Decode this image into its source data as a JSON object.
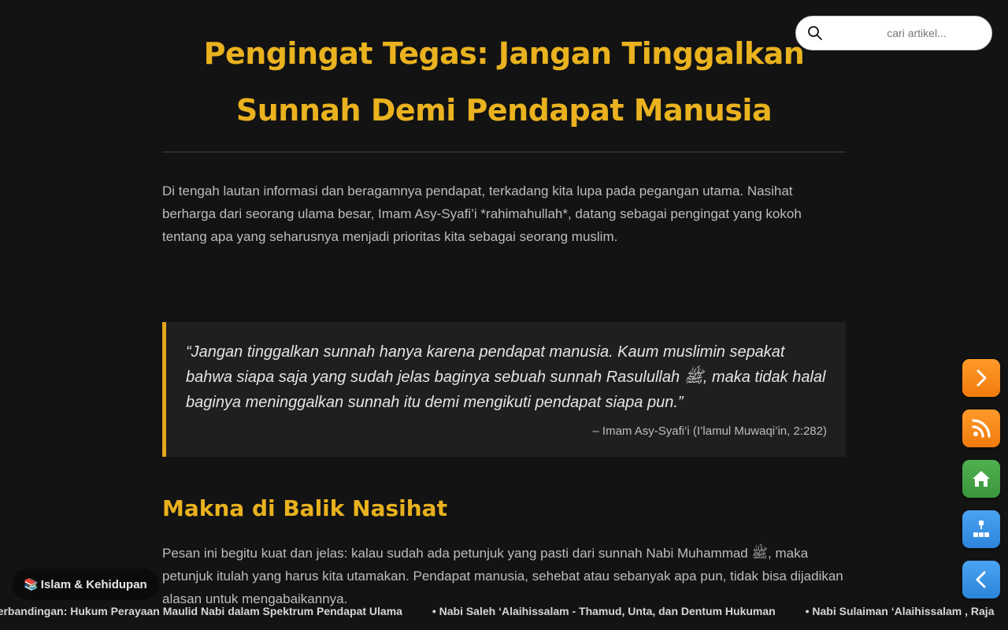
{
  "search": {
    "placeholder": "cari artikel...",
    "icon": "search-icon"
  },
  "article": {
    "title": "Pengingat Tegas: Jangan Tinggalkan Sunnah Demi Pendapat Manusia",
    "intro": "Di tengah lautan informasi dan beragamnya pendapat, terkadang kita lupa pada pegangan utama. Nasihat berharga dari seorang ulama besar, Imam Asy-Syafi’i *rahimahullah*, datang sebagai pengingat yang kokoh tentang apa yang seharusnya menjadi prioritas kita sebagai seorang muslim.",
    "quote": {
      "text": "“Jangan tinggalkan sunnah hanya karena pendapat manusia. Kaum muslimin sepakat bahwa siapa saja yang sudah jelas baginya sebuah sunnah Rasulullah ﷺ, maka tidak halal baginya meninggalkan sunnah itu demi mengikuti pendapat siapa pun.”",
      "source": "– Imam Asy-Syafi’i (I’lamul Muwaqi’in, 2:282)"
    },
    "section_heading": "Makna di Balik Nasihat",
    "section_body": "Pesan ini begitu kuat dan jelas: kalau sudah ada petunjuk yang pasti dari sunnah Nabi Muhammad ﷺ, maka petunjuk itulah yang harus kita utamakan. Pendapat manusia, sehebat atau sebanyak apa pun, tidak bisa dijadikan alasan untuk mengabaikannya."
  },
  "side_nav": [
    {
      "name": "next-post-button",
      "icon": "chevron-right-icon",
      "color": "#f58a17"
    },
    {
      "name": "rss-button",
      "icon": "rss-icon",
      "color": "#f58a17"
    },
    {
      "name": "home-button",
      "icon": "home-icon",
      "color": "#45a545"
    },
    {
      "name": "sitemap-button",
      "icon": "sitemap-icon",
      "color": "#3594e6"
    },
    {
      "name": "prev-post-button",
      "icon": "chevron-left-icon",
      "color": "#3594e6"
    }
  ],
  "category": {
    "emoji": "📚",
    "label": "Islam & Kehidupan"
  },
  "ticker": [
    "sis Perbandingan: Hukum Perayaan Maulid Nabi dalam Spektrum Pendapat Ulama",
    "• Nabi Saleh ‘Alaihissalam - Thamud, Unta, dan Dentum Hukuman",
    "• Nabi Sulaiman ‘Alaihissalam , Raja"
  ],
  "colors": {
    "background": "#131313",
    "accent": "#e9b21e",
    "quote_bg": "#1f1f1f",
    "text": "#bdbdbd"
  }
}
